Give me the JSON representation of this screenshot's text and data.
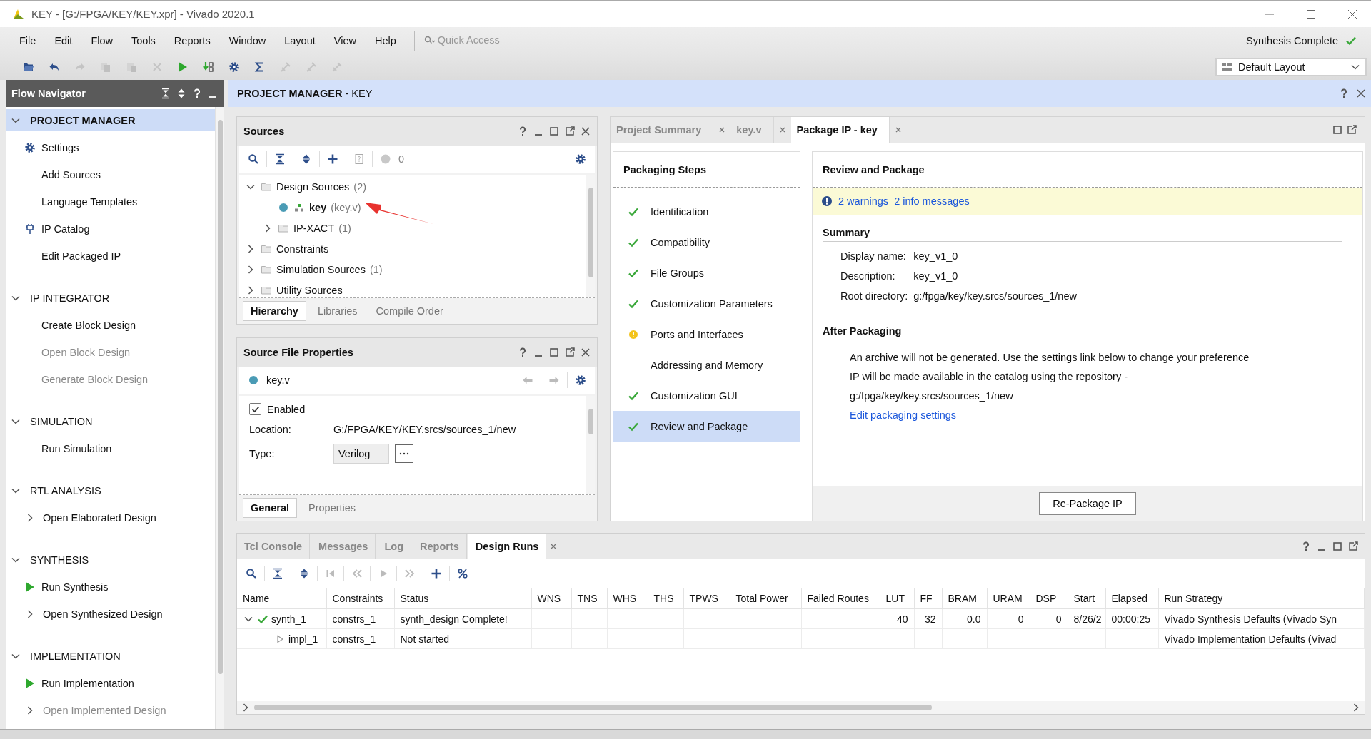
{
  "window": {
    "title": "KEY - [G:/FPGA/KEY/KEY.xpr] - Vivado 2020.1"
  },
  "menu": [
    "File",
    "Edit",
    "Flow",
    "Tools",
    "Reports",
    "Window",
    "Layout",
    "View",
    "Help"
  ],
  "quick_access": {
    "placeholder": "Quick Access"
  },
  "run_status": {
    "text": "Synthesis Complete",
    "done": true
  },
  "layout_select": {
    "value": "Default Layout"
  },
  "flow_navigator": {
    "title": "Flow Navigator",
    "sections": [
      {
        "title": "PROJECT MANAGER",
        "selected": true,
        "expanded": true,
        "items": [
          {
            "label": "Settings",
            "kind": "settings",
            "disabled": false
          },
          {
            "label": "Add Sources",
            "kind": "action",
            "disabled": false
          },
          {
            "label": "Language Templates",
            "kind": "action",
            "disabled": false
          },
          {
            "label": "IP Catalog",
            "kind": "catalog",
            "disabled": false
          },
          {
            "label": "Edit Packaged IP",
            "kind": "action",
            "disabled": false
          }
        ]
      },
      {
        "title": "IP INTEGRATOR",
        "selected": false,
        "expanded": true,
        "items": [
          {
            "label": "Create Block Design",
            "kind": "action",
            "disabled": false
          },
          {
            "label": "Open Block Design",
            "kind": "action",
            "disabled": true
          },
          {
            "label": "Generate Block Design",
            "kind": "action",
            "disabled": true
          }
        ]
      },
      {
        "title": "SIMULATION",
        "selected": false,
        "expanded": true,
        "items": [
          {
            "label": "Run Simulation",
            "kind": "action",
            "disabled": false
          }
        ]
      },
      {
        "title": "RTL ANALYSIS",
        "selected": false,
        "expanded": true,
        "items": [
          {
            "label": "Open Elaborated Design",
            "kind": "submenu",
            "disabled": false
          }
        ]
      },
      {
        "title": "SYNTHESIS",
        "selected": false,
        "expanded": true,
        "items": [
          {
            "label": "Run Synthesis",
            "kind": "run",
            "disabled": false
          },
          {
            "label": "Open Synthesized Design",
            "kind": "submenu",
            "disabled": false
          }
        ]
      },
      {
        "title": "IMPLEMENTATION",
        "selected": false,
        "expanded": true,
        "items": [
          {
            "label": "Run Implementation",
            "kind": "run",
            "disabled": false
          },
          {
            "label": "Open Implemented Design",
            "kind": "submenu",
            "disabled": true
          }
        ]
      }
    ]
  },
  "main_header": {
    "title": "**PROJECT MANAGER** - KEY"
  },
  "sources": {
    "title": "Sources",
    "error_count": "0",
    "tree": [
      {
        "kind": "folder",
        "label": "Design Sources",
        "count": "(2)",
        "expanded": true,
        "children": [
          {
            "kind": "module",
            "label": "key",
            "file": "(key.v)"
          },
          {
            "kind": "folder",
            "label": "IP-XACT",
            "count": "(1)",
            "expanded": false
          }
        ]
      },
      {
        "kind": "folder",
        "label": "Constraints",
        "expanded": false
      },
      {
        "kind": "folder",
        "label": "Simulation Sources",
        "count": "(1)",
        "expanded": false
      },
      {
        "kind": "folder",
        "label": "Utility Sources",
        "expanded": false
      }
    ],
    "tabs": [
      {
        "label": "Hierarchy",
        "selected": true
      },
      {
        "label": "Libraries",
        "selected": false
      },
      {
        "label": "Compile Order",
        "selected": false
      }
    ]
  },
  "source_file_properties": {
    "title": "Source File Properties",
    "file": "key.v",
    "enabled": {
      "label": "Enabled",
      "checked": true
    },
    "location": {
      "label": "Location:",
      "value": "G:/FPGA/KEY/KEY.srcs/sources_1/new"
    },
    "type": {
      "label": "Type:",
      "value": "Verilog"
    },
    "tabs": [
      {
        "label": "General",
        "selected": true
      },
      {
        "label": "Properties",
        "selected": false
      }
    ]
  },
  "editor_tabs": [
    {
      "label": "Project Summary",
      "selected": false
    },
    {
      "label": "key.v",
      "selected": false
    },
    {
      "label": "Package IP - key",
      "selected": true
    }
  ],
  "packaging_steps": {
    "title": "Packaging Steps",
    "steps": [
      {
        "label": "Identification",
        "kind": "done",
        "selected": false
      },
      {
        "label": "Compatibility",
        "kind": "done",
        "selected": false
      },
      {
        "label": "File Groups",
        "kind": "done",
        "selected": false
      },
      {
        "label": "Customization Parameters",
        "kind": "done",
        "selected": false
      },
      {
        "label": "Ports and Interfaces",
        "kind": "warning",
        "selected": false
      },
      {
        "label": "Addressing and Memory",
        "kind": "pending",
        "selected": false
      },
      {
        "label": "Customization GUI",
        "kind": "done",
        "selected": false
      },
      {
        "label": "Review and Package",
        "kind": "done",
        "selected": true
      }
    ]
  },
  "review": {
    "title": "Review and Package",
    "warnings": "2 warnings",
    "info": "2 info messages",
    "summary": {
      "title": "Summary",
      "fields": [
        {
          "label": "Display name:",
          "value": "key_v1_0"
        },
        {
          "label": "Description:",
          "value": "key_v1_0"
        },
        {
          "label": "Root directory:",
          "value": "g:/fpga/key/key.srcs/sources_1/new"
        }
      ]
    },
    "after": {
      "title": "After Packaging",
      "lines": [
        "An archive will not be generated. Use the settings link below to change your preference",
        "IP will be made available in the catalog using the repository -",
        "g:/fpga/key/key.srcs/sources_1/new"
      ],
      "link": "Edit packaging settings"
    },
    "button": "Re-Package IP"
  },
  "design_runs": {
    "tabs": [
      {
        "label": "Tcl Console",
        "selected": false
      },
      {
        "label": "Messages",
        "selected": false
      },
      {
        "label": "Log",
        "selected": false
      },
      {
        "label": "Reports",
        "selected": false
      },
      {
        "label": "Design Runs",
        "selected": true
      }
    ],
    "columns": [
      "Name",
      "Constraints",
      "Status",
      "WNS",
      "TNS",
      "WHS",
      "THS",
      "TPWS",
      "Total Power",
      "Failed Routes",
      "LUT",
      "FF",
      "BRAM",
      "URAM",
      "DSP",
      "Start",
      "Elapsed",
      "Run Strategy"
    ],
    "rows": [
      {
        "kind": "done",
        "expanded": true,
        "cells": [
          "synth_1",
          "constrs_1",
          "synth_design Complete!",
          "",
          "",
          "",
          "",
          "",
          "",
          "",
          "40",
          "32",
          "0.0",
          "0",
          "0",
          "8/26/2",
          "00:00:25",
          "Vivado Synthesis Defaults (Vivado Syn"
        ],
        "children": [
          {
            "kind": "pending",
            "cells": [
              "impl_1",
              "constrs_1",
              "Not started",
              "",
              "",
              "",
              "",
              "",
              "",
              "",
              "",
              "",
              "",
              "",
              "",
              "",
              "",
              "Vivado Implementation Defaults (Vivad"
            ]
          }
        ]
      }
    ]
  }
}
